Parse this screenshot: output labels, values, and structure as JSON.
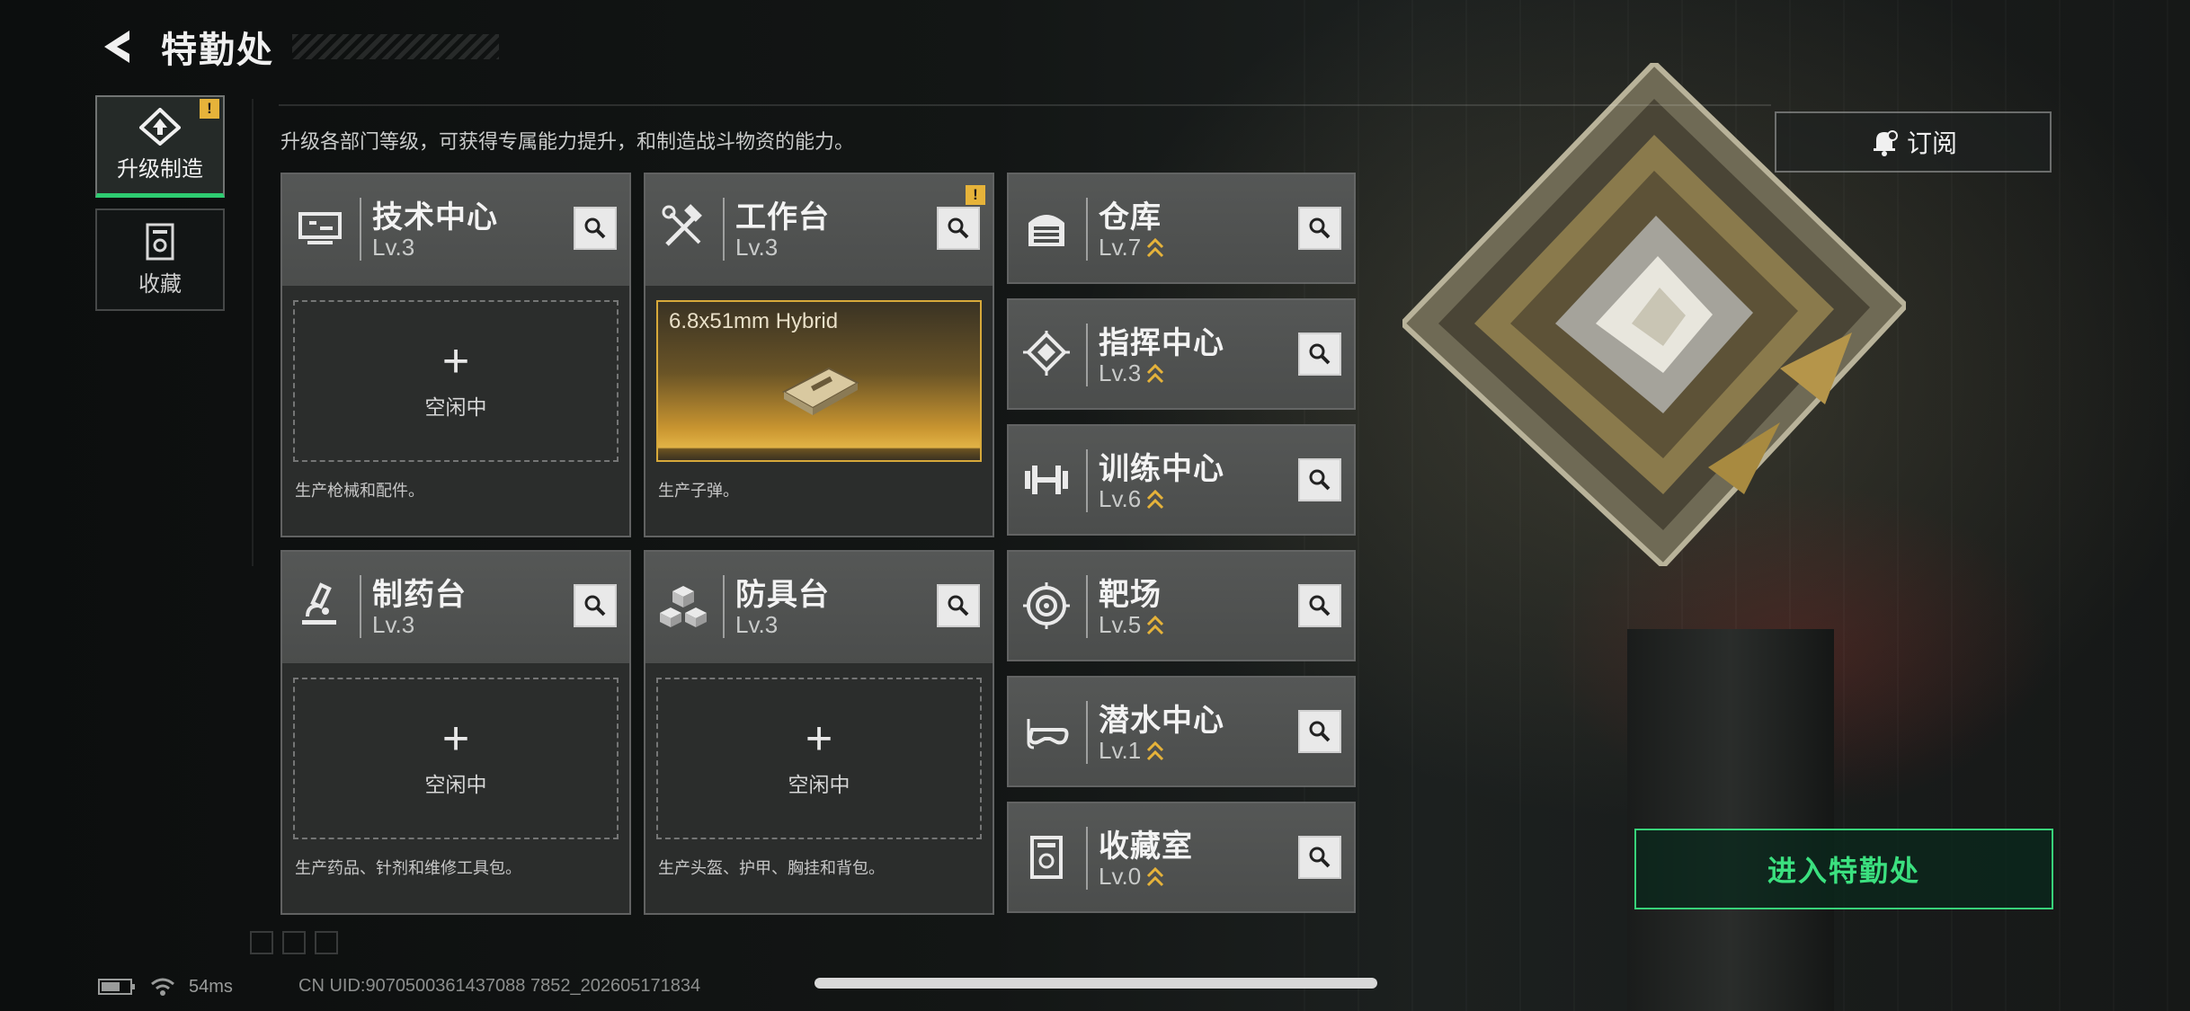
{
  "header": {
    "title": "特勤处"
  },
  "description": "升级各部门等级，可获得专属能力提升，和制造战斗物资的能力。",
  "nav": [
    {
      "label": "升级制造",
      "active": true,
      "badge": "!"
    },
    {
      "label": "收藏",
      "active": false
    }
  ],
  "workshops": [
    {
      "name": "技术中心",
      "level": "Lv.3",
      "slot_state": "空闲中",
      "description": "生产枪械和配件。"
    },
    {
      "name": "工作台",
      "level": "Lv.3",
      "badge": "!",
      "item": "6.8x51mm Hybrid",
      "description": "生产子弹。"
    },
    {
      "name": "制药台",
      "level": "Lv.3",
      "slot_state": "空闲中",
      "description": "生产药品、针剂和维修工具包。"
    },
    {
      "name": "防具台",
      "level": "Lv.3",
      "slot_state": "空闲中",
      "description": "生产头盔、护甲、胸挂和背包。"
    }
  ],
  "departments": [
    {
      "name": "仓库",
      "level": "Lv.7",
      "icon": "warehouse-icon"
    },
    {
      "name": "指挥中心",
      "level": "Lv.3",
      "icon": "command-chip-icon"
    },
    {
      "name": "训练中心",
      "level": "Lv.6",
      "icon": "dumbbell-icon"
    },
    {
      "name": "靶场",
      "level": "Lv.5",
      "icon": "target-icon"
    },
    {
      "name": "潜水中心",
      "level": "Lv.1",
      "icon": "diving-mask-icon"
    },
    {
      "name": "收藏室",
      "level": "Lv.0",
      "icon": "collection-icon"
    }
  ],
  "subscribe_label": "订阅",
  "enter_label": "进入特勤处",
  "status": {
    "ping": "54ms",
    "uid": "CN UID:9070500361437088 7852_202605171834"
  },
  "colors": {
    "accent_green": "#38d37a",
    "upgrade_gold": "#e6b33a",
    "card_bg": "#525453"
  }
}
